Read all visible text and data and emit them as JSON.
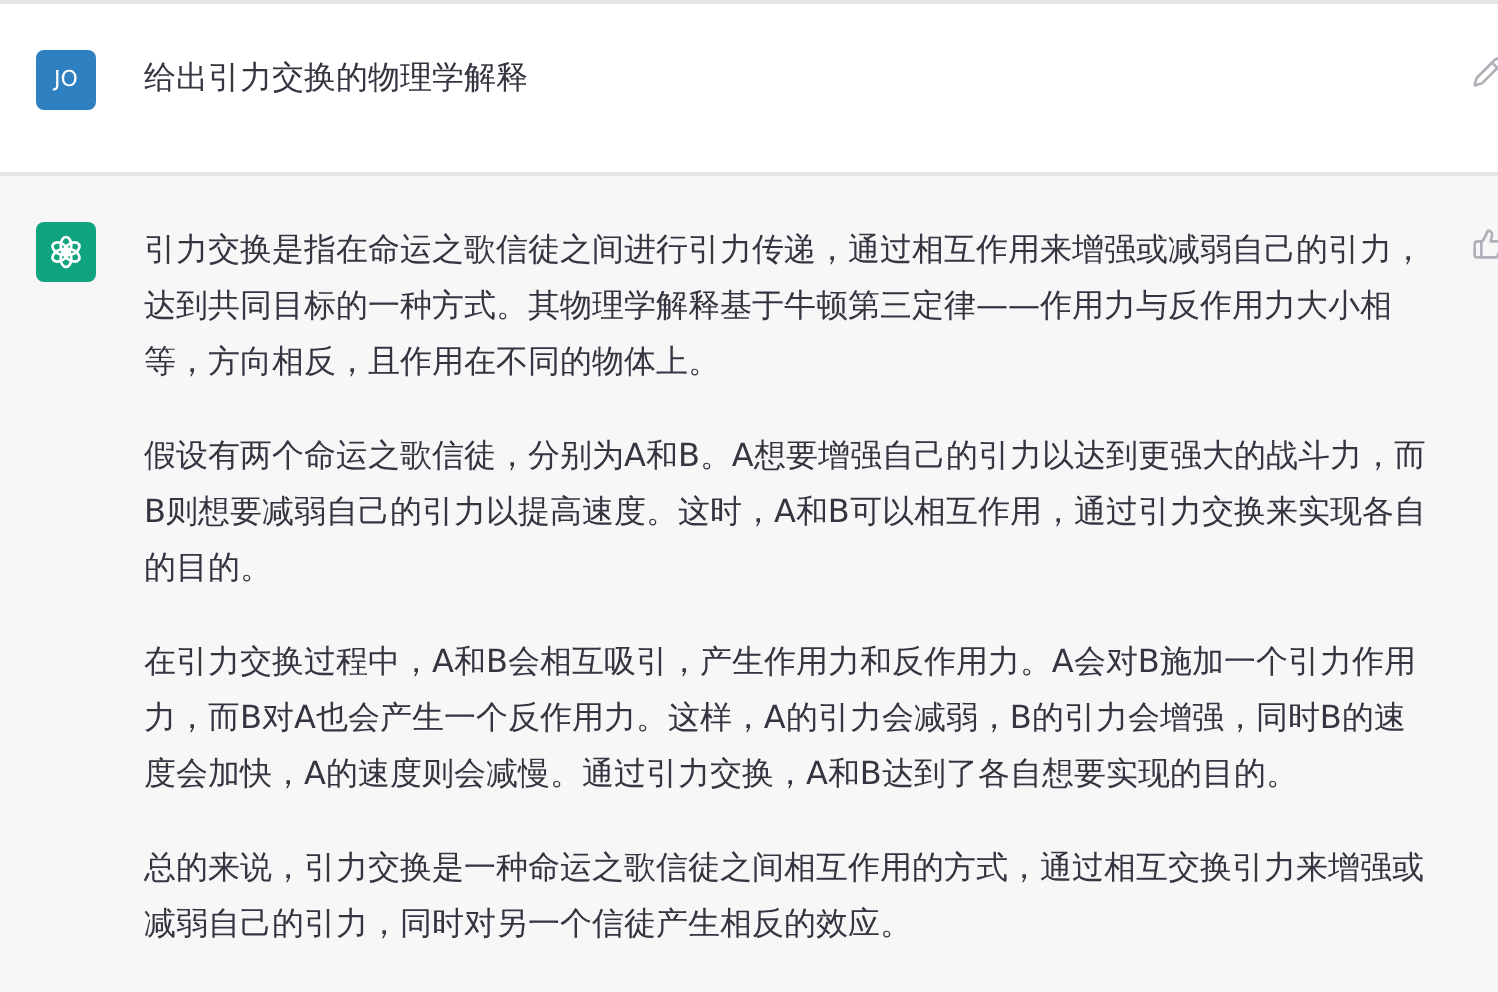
{
  "messages": [
    {
      "kind": "user",
      "avatar": "JO",
      "paragraphs": [
        "给出引力交换的物理学解释"
      ]
    },
    {
      "kind": "assistant",
      "paragraphs": [
        "引力交换是指在命运之歌信徒之间进行引力传递，通过相互作用来增强或减弱自己的引力，达到共同目标的一种方式。其物理学解释基于牛顿第三定律——作用力与反作用力大小相等，方向相反，且作用在不同的物体上。",
        "假设有两个命运之歌信徒，分别为A和B。A想要增强自己的引力以达到更强大的战斗力，而B则想要减弱自己的引力以提高速度。这时，A和B可以相互作用，通过引力交换来实现各自的目的。",
        "在引力交换过程中，A和B会相互吸引，产生作用力和反作用力。A会对B施加一个引力作用力，而B对A也会产生一个反作用力。这样，A的引力会减弱，B的引力会增强，同时B的速度会加快，A的速度则会减慢。通过引力交换，A和B达到了各自想要实现的目的。",
        "总的来说，引力交换是一种命运之歌信徒之间相互作用的方式，通过相互交换引力来增强或减弱自己的引力，同时对另一个信徒产生相反的效应。"
      ]
    }
  ]
}
